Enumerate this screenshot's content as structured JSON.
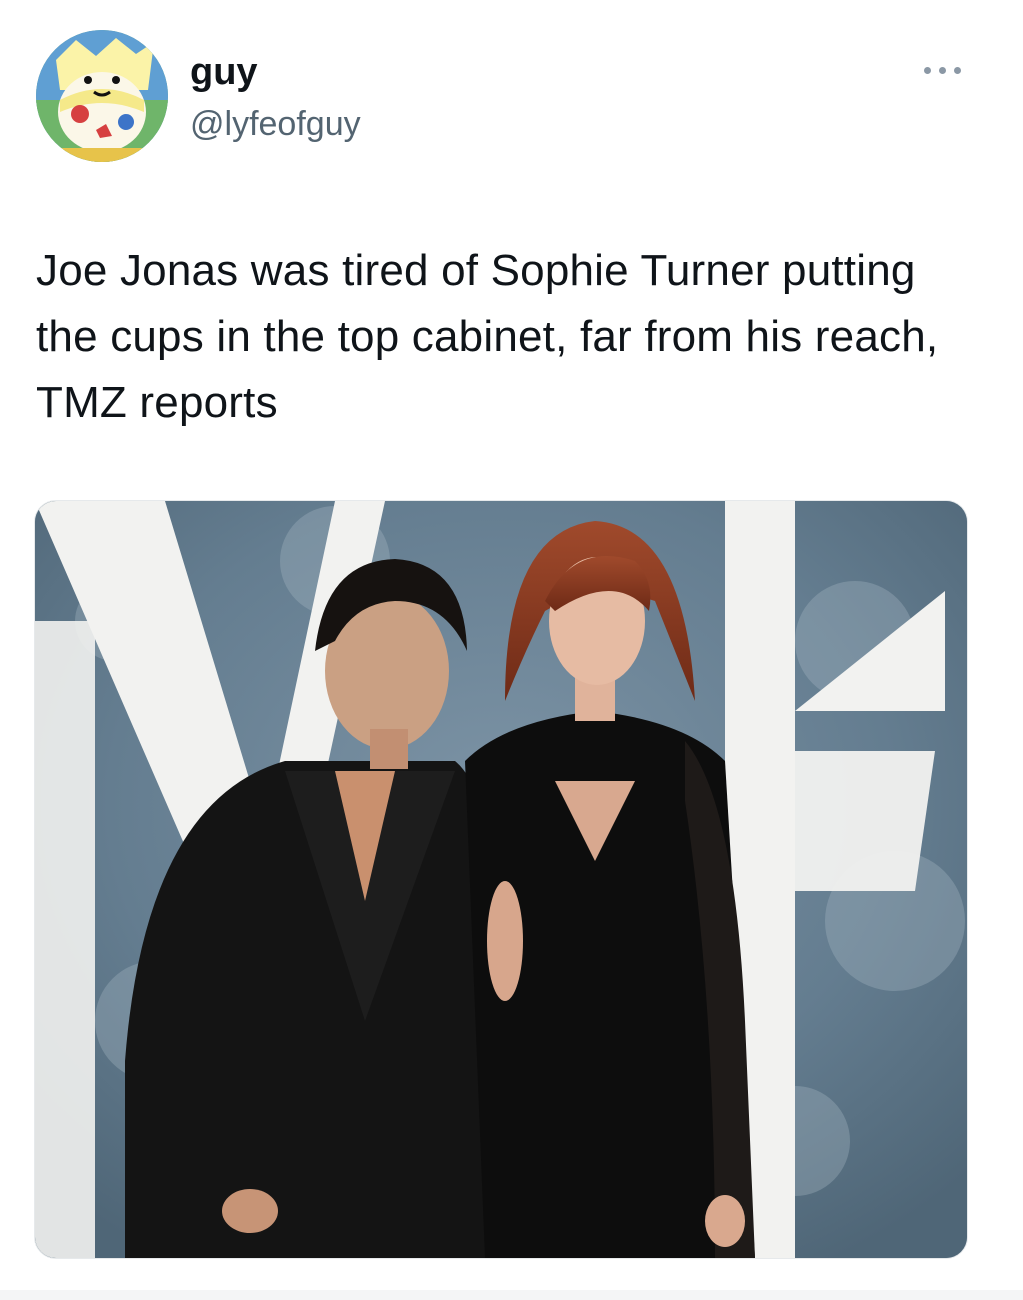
{
  "tweet": {
    "display_name": "guy",
    "handle": "@lyfeofguy",
    "text": "Joe Jonas was tired of Sophie Turner putting the cups in the top cabinet, far from his reach, TMZ reports",
    "avatar_icon": "togepi-avatar",
    "more_icon": "more-options-icon",
    "media_icon": "photo-media"
  },
  "colors": {
    "text_primary": "#0f1419",
    "text_secondary": "#536471",
    "backdrop_blue": "#6a8294",
    "backdrop_white": "#f2f2f0",
    "black_outfit": "#111111",
    "hair_red": "#8a3a22"
  }
}
